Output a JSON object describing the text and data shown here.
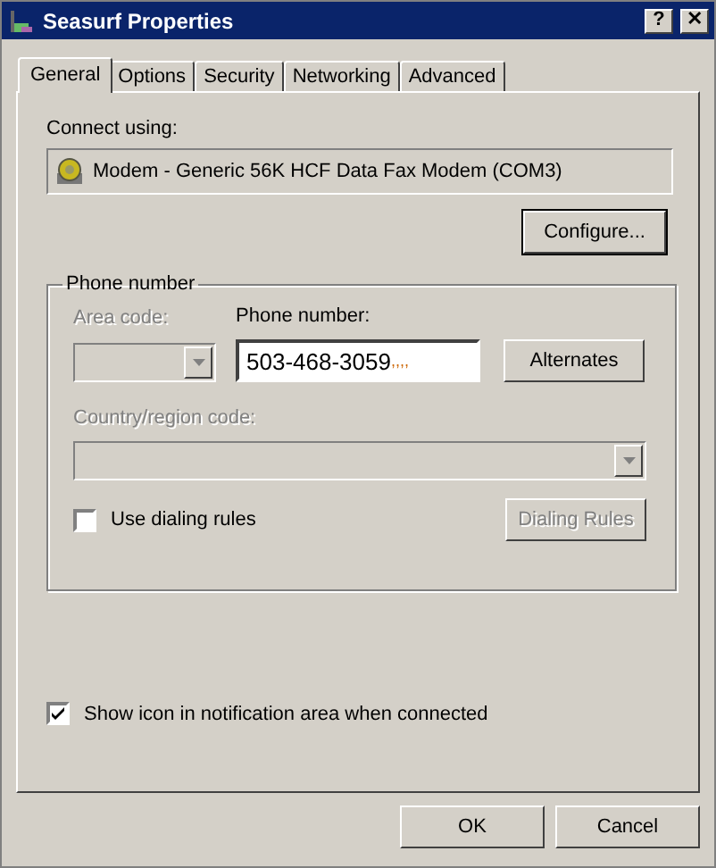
{
  "window": {
    "title": "Seasurf Properties",
    "buttons": [
      "?",
      "✕"
    ]
  },
  "tabs": [
    {
      "label": "General",
      "selected": true
    },
    {
      "label": "Options",
      "selected": false
    },
    {
      "label": "Security",
      "selected": false
    },
    {
      "label": "Networking",
      "selected": false
    },
    {
      "label": "Advanced",
      "selected": false
    }
  ],
  "connect_using": {
    "label": "Connect using:",
    "device": "Modem - Generic 56K HCF Data Fax Modem (COM3)",
    "configure_button": "Configure..."
  },
  "phone_group": {
    "title": "Phone number",
    "area_code": {
      "label": "Area code:",
      "disabled": true
    },
    "phone_number": {
      "label": "Phone number:",
      "value": "503-468-3059",
      "suffix": ",,,,"
    },
    "alternates_button": {
      "label": "Alternates",
      "disabled": false
    },
    "country_code": {
      "label": "Country/region code:",
      "disabled": true
    },
    "use_dialing_rules": {
      "label": "Use dialing rules",
      "checked": false
    },
    "dialing_rules_button": {
      "label": "Dialing Rules",
      "disabled": true
    }
  },
  "show_icon": {
    "label": "Show icon in notification area when connected",
    "checked": true
  },
  "buttons": [
    {
      "label": "OK"
    },
    {
      "label": "Cancel"
    }
  ]
}
